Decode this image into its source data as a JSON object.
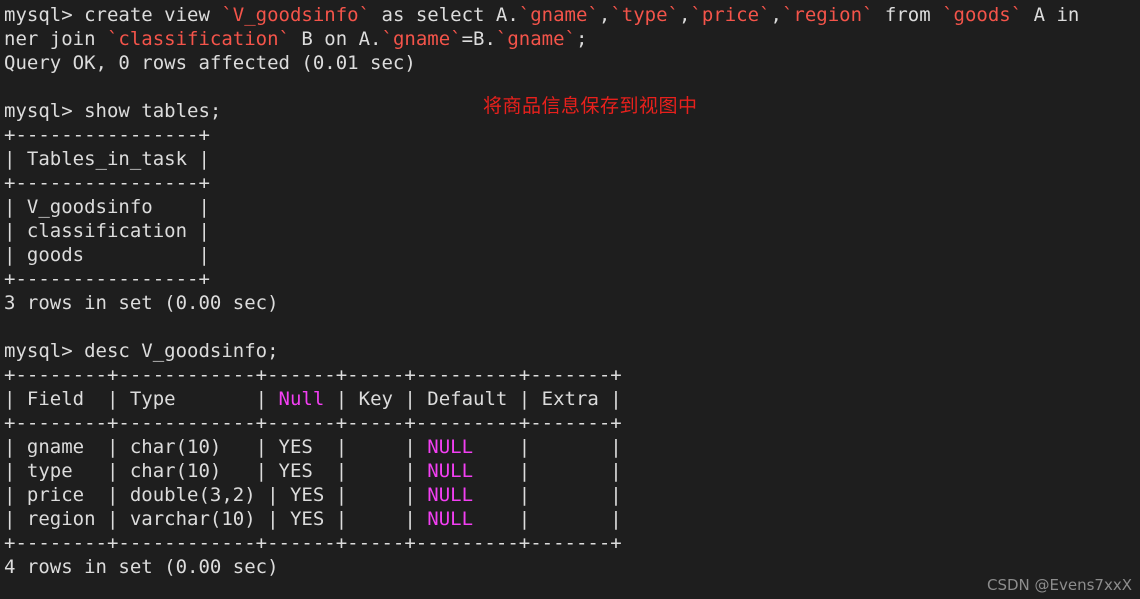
{
  "terminal": {
    "background_color": "#1e1e1e",
    "default_text_color": "#dcdcdc",
    "identifier_color": "#f4544a",
    "null_color": "#f33ff3",
    "prompt": "mysql>",
    "lines": [
      {
        "name": "command-create-view",
        "segments": [
          {
            "text": "mysql> create view ",
            "color": "default"
          },
          {
            "text": "`V_goodsinfo`",
            "color": "ident"
          },
          {
            "text": " as select A.",
            "color": "default"
          },
          {
            "text": "`gname`",
            "color": "ident"
          },
          {
            "text": ",",
            "color": "default"
          },
          {
            "text": "`type`",
            "color": "ident"
          },
          {
            "text": ",",
            "color": "default"
          },
          {
            "text": "`price`",
            "color": "ident"
          },
          {
            "text": ",",
            "color": "default"
          },
          {
            "text": "`region`",
            "color": "ident"
          },
          {
            "text": " from ",
            "color": "default"
          },
          {
            "text": "`goods`",
            "color": "ident"
          },
          {
            "text": " A in",
            "color": "default"
          }
        ]
      },
      {
        "name": "command-create-view-wrap",
        "segments": [
          {
            "text": "ner join ",
            "color": "default"
          },
          {
            "text": "`classification`",
            "color": "ident"
          },
          {
            "text": " B on A.",
            "color": "default"
          },
          {
            "text": "`gname`",
            "color": "ident"
          },
          {
            "text": "=B.",
            "color": "default"
          },
          {
            "text": "`gname`",
            "color": "ident"
          },
          {
            "text": ";",
            "color": "default"
          }
        ]
      },
      {
        "name": "result-query-ok",
        "segments": [
          {
            "text": "Query OK, 0 rows affected (0.01 sec)",
            "color": "default"
          }
        ]
      },
      {
        "name": "blank-line",
        "segments": [
          {
            "text": "",
            "color": "default"
          }
        ]
      },
      {
        "name": "command-show-tables",
        "segments": [
          {
            "text": "mysql> show tables;",
            "color": "default"
          }
        ]
      },
      {
        "name": "tables-border-top",
        "segments": [
          {
            "text": "+----------------+",
            "color": "default"
          }
        ]
      },
      {
        "name": "tables-header-row",
        "segments": [
          {
            "text": "| Tables_in_task |",
            "color": "default"
          }
        ]
      },
      {
        "name": "tables-border-mid",
        "segments": [
          {
            "text": "+----------------+",
            "color": "default"
          }
        ]
      },
      {
        "name": "tables-row-v-goodsinfo",
        "segments": [
          {
            "text": "| V_goodsinfo    |",
            "color": "default"
          }
        ]
      },
      {
        "name": "tables-row-classification",
        "segments": [
          {
            "text": "| classification |",
            "color": "default"
          }
        ]
      },
      {
        "name": "tables-row-goods",
        "segments": [
          {
            "text": "| goods          |",
            "color": "default"
          }
        ]
      },
      {
        "name": "tables-border-bottom",
        "segments": [
          {
            "text": "+----------------+",
            "color": "default"
          }
        ]
      },
      {
        "name": "result-tables-rowcount",
        "segments": [
          {
            "text": "3 rows in set (0.00 sec)",
            "color": "default"
          }
        ]
      },
      {
        "name": "blank-line",
        "segments": [
          {
            "text": "",
            "color": "default"
          }
        ]
      },
      {
        "name": "command-desc-view",
        "segments": [
          {
            "text": "mysql> desc V_goodsinfo;",
            "color": "default"
          }
        ]
      },
      {
        "name": "desc-border-top",
        "segments": [
          {
            "text": "+--------+------------+------+-----+---------+-------+",
            "color": "default"
          }
        ]
      },
      {
        "name": "desc-header-row",
        "segments": [
          {
            "text": "| Field  | Type       | ",
            "color": "default"
          },
          {
            "text": "Null",
            "color": "null"
          },
          {
            "text": " | Key | Default | Extra |",
            "color": "default"
          }
        ]
      },
      {
        "name": "desc-border-mid",
        "segments": [
          {
            "text": "+--------+------------+------+-----+---------+-------+",
            "color": "default"
          }
        ]
      },
      {
        "name": "desc-row-gname",
        "segments": [
          {
            "text": "| gname  | char(10)   | YES  |     | ",
            "color": "default"
          },
          {
            "text": "NULL",
            "color": "null"
          },
          {
            "text": "    |       |",
            "color": "default"
          }
        ]
      },
      {
        "name": "desc-row-type",
        "segments": [
          {
            "text": "| type   | char(10)   | YES  |     | ",
            "color": "default"
          },
          {
            "text": "NULL",
            "color": "null"
          },
          {
            "text": "    |       |",
            "color": "default"
          }
        ]
      },
      {
        "name": "desc-row-price",
        "segments": [
          {
            "text": "| price  | double(3,2) | YES |     | ",
            "color": "default"
          },
          {
            "text": "NULL",
            "color": "null"
          },
          {
            "text": "    |       |",
            "color": "default"
          }
        ]
      },
      {
        "name": "desc-row-region",
        "segments": [
          {
            "text": "| region | varchar(10) | YES |     | ",
            "color": "default"
          },
          {
            "text": "NULL",
            "color": "null"
          },
          {
            "text": "    |       |",
            "color": "default"
          }
        ]
      },
      {
        "name": "desc-border-bottom",
        "segments": [
          {
            "text": "+--------+------------+------+-----+---------+-------+",
            "color": "default"
          }
        ]
      },
      {
        "name": "result-desc-rowcount",
        "segments": [
          {
            "text": "4 rows in set (0.00 sec)",
            "color": "default"
          }
        ]
      }
    ]
  },
  "tables_result": {
    "column_header": "Tables_in_task",
    "rows": [
      "V_goodsinfo",
      "classification",
      "goods"
    ],
    "row_count_text": "3 rows in set (0.00 sec)"
  },
  "desc_result": {
    "columns": [
      "Field",
      "Type",
      "Null",
      "Key",
      "Default",
      "Extra"
    ],
    "rows": [
      {
        "Field": "gname",
        "Type": "char(10)",
        "Null": "YES",
        "Key": "",
        "Default": "NULL",
        "Extra": ""
      },
      {
        "Field": "type",
        "Type": "char(10)",
        "Null": "YES",
        "Key": "",
        "Default": "NULL",
        "Extra": ""
      },
      {
        "Field": "price",
        "Type": "double(3,2)",
        "Null": "YES",
        "Key": "",
        "Default": "NULL",
        "Extra": ""
      },
      {
        "Field": "region",
        "Type": "varchar(10)",
        "Null": "YES",
        "Key": "",
        "Default": "NULL",
        "Extra": ""
      }
    ],
    "row_count_text": "4 rows in set (0.00 sec)"
  },
  "annotation": {
    "text": "将商品信息保存到视图中",
    "color": "#e8201c"
  },
  "watermark": {
    "text": "CSDN @Evens7xxX",
    "color": "#8d8d8d"
  }
}
